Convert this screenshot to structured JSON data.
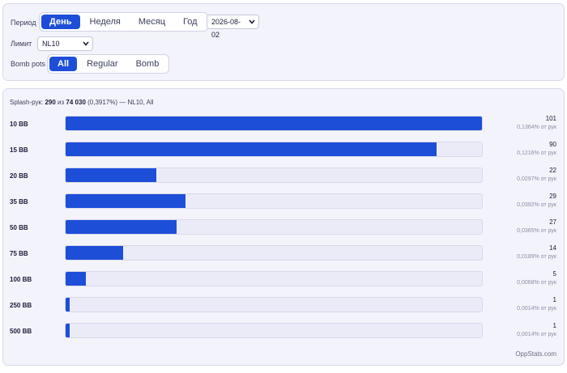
{
  "filters": {
    "period_label": "Период",
    "period_options": [
      "День",
      "Неделя",
      "Месяц",
      "Год"
    ],
    "period_active": 0,
    "date_value": "2026-08-02",
    "limit_label": "Лимит",
    "limit_value": "NL10",
    "bomb_label": "Bomb pots",
    "bomb_options": [
      "All",
      "Regular",
      "Bomb"
    ],
    "bomb_active": 0
  },
  "summary": {
    "prefix": "Splash-рук:",
    "splash_count": "290",
    "of_word": "из",
    "total_hands": "74 030",
    "percent": "(0,3917%)",
    "suffix": "— NL10, All"
  },
  "rows": [
    {
      "label": "10 BB",
      "count": "101",
      "pct": "0,1364% от рук",
      "value": 101
    },
    {
      "label": "15 BB",
      "count": "90",
      "pct": "0,1216% от рук",
      "value": 90
    },
    {
      "label": "20 BB",
      "count": "22",
      "pct": "0,0297% от рук",
      "value": 22
    },
    {
      "label": "35 BB",
      "count": "29",
      "pct": "0,0392% от рук",
      "value": 29
    },
    {
      "label": "50 BB",
      "count": "27",
      "pct": "0,0365% от рук",
      "value": 27
    },
    {
      "label": "75 BB",
      "count": "14",
      "pct": "0,0189% от рук",
      "value": 14
    },
    {
      "label": "100 BB",
      "count": "5",
      "pct": "0,0068% от рук",
      "value": 5
    },
    {
      "label": "250 BB",
      "count": "1",
      "pct": "0,0014% от рук",
      "value": 1
    },
    {
      "label": "500 BB",
      "count": "1",
      "pct": "0,0014% от рук",
      "value": 1
    }
  ],
  "max_value": 101,
  "footer": "OppStats.com",
  "colors": {
    "accent": "#1d4ed8",
    "track": "#ebebf8",
    "panel": "#f3f3fb"
  }
}
